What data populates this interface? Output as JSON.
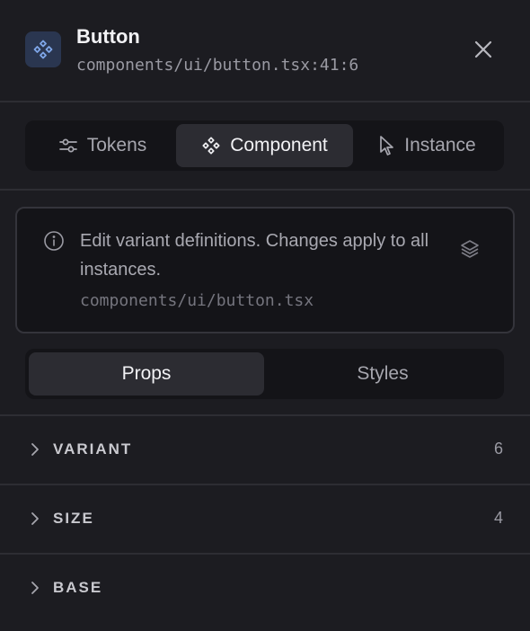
{
  "header": {
    "title": "Button",
    "subtitle": "components/ui/button.tsx:41:6",
    "icon": "component-icon",
    "close_icon": "close-icon"
  },
  "mode_tabs": [
    {
      "label": "Tokens",
      "icon": "sliders-icon",
      "active": false
    },
    {
      "label": "Component",
      "icon": "component-icon",
      "active": true
    },
    {
      "label": "Instance",
      "icon": "cursor-pointer-icon",
      "active": false
    }
  ],
  "info": {
    "message": "Edit variant definitions. Changes apply to all instances.",
    "path": "components/ui/button.tsx",
    "icon": "info-icon",
    "action_icon": "layers-icon"
  },
  "sub_tabs": [
    {
      "label": "Props",
      "active": true
    },
    {
      "label": "Styles",
      "active": false
    }
  ],
  "sections": [
    {
      "label": "VARIANT",
      "count": "6"
    },
    {
      "label": "SIZE",
      "count": "4"
    },
    {
      "label": "BASE",
      "count": ""
    }
  ],
  "colors": {
    "background": "#1c1c21",
    "surface": "#141418",
    "active_tab": "#2c2c32",
    "accent_badge": "#2a3650",
    "accent_icon": "#7ea6e8"
  }
}
